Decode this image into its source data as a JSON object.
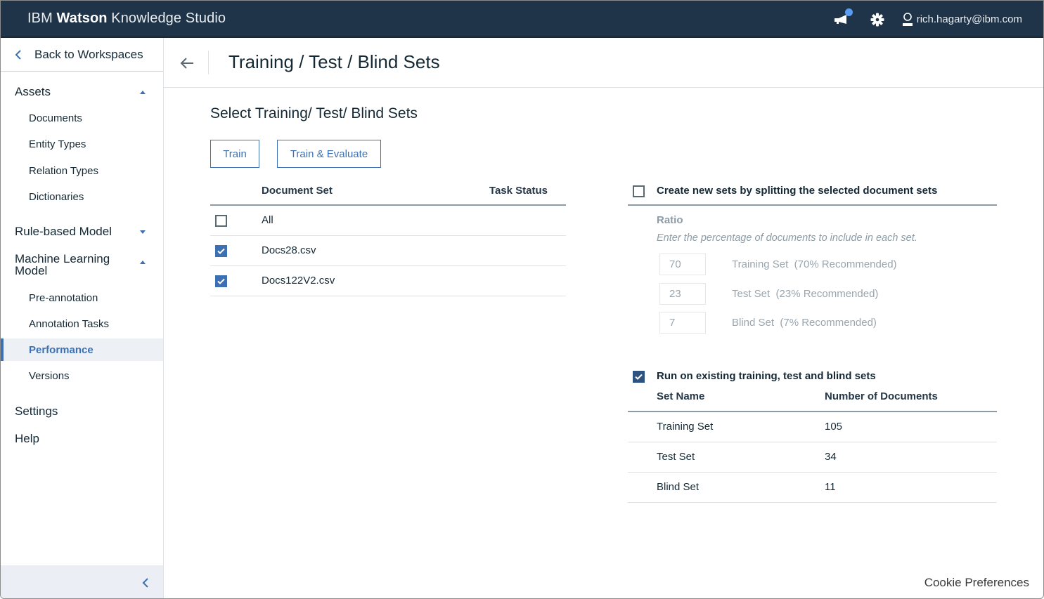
{
  "app": {
    "brand_prefix": "IBM ",
    "brand_bold": "Watson",
    "brand_suffix": " Knowledge Studio",
    "user_email": "rich.hagarty@ibm.com",
    "notification_badge_color": "#5a9cf0",
    "accent_color": "#3d70b2"
  },
  "sidebar": {
    "back_label": "Back to Workspaces",
    "sections": [
      {
        "label": "Assets",
        "expanded": true,
        "items": [
          "Documents",
          "Entity Types",
          "Relation Types",
          "Dictionaries"
        ]
      },
      {
        "label": "Rule-based Model",
        "expanded": false,
        "items": []
      },
      {
        "label": "Machine Learning Model",
        "expanded": true,
        "items": [
          "Pre-annotation",
          "Annotation Tasks",
          "Performance",
          "Versions"
        ]
      }
    ],
    "settings_label": "Settings",
    "help_label": "Help",
    "active_item": "Performance"
  },
  "page": {
    "title": "Training / Test / Blind Sets",
    "section_title": "Select Training/ Test/ Blind Sets",
    "buttons": {
      "train": "Train",
      "train_evaluate": "Train & Evaluate"
    }
  },
  "document_table": {
    "columns": [
      "Document Set",
      "Task Status"
    ],
    "rows": [
      {
        "name": "All",
        "checked": false,
        "status": ""
      },
      {
        "name": "Docs28.csv",
        "checked": true,
        "status": ""
      },
      {
        "name": "Docs122V2.csv",
        "checked": true,
        "status": ""
      }
    ]
  },
  "split_option": {
    "label": "Create new sets by splitting the selected document sets",
    "checked": false,
    "ratio_label": "Ratio",
    "ratio_hint": "Enter the percentage of documents to include in each set.",
    "ratios": [
      {
        "value": "70",
        "label": "Training Set  (70% Recommended)"
      },
      {
        "value": "23",
        "label": "Test Set  (23% Recommended)"
      },
      {
        "value": "7",
        "label": "Blind Set  (7% Recommended)"
      }
    ]
  },
  "existing_option": {
    "label": "Run on existing training, test and blind sets",
    "checked": true,
    "columns": [
      "Set Name",
      "Number of Documents"
    ],
    "rows": [
      {
        "name": "Training Set",
        "count": "105"
      },
      {
        "name": "Test Set",
        "count": "34"
      },
      {
        "name": "Blind Set",
        "count": "11"
      }
    ]
  },
  "footer": {
    "cookie_label": "Cookie Preferences"
  }
}
